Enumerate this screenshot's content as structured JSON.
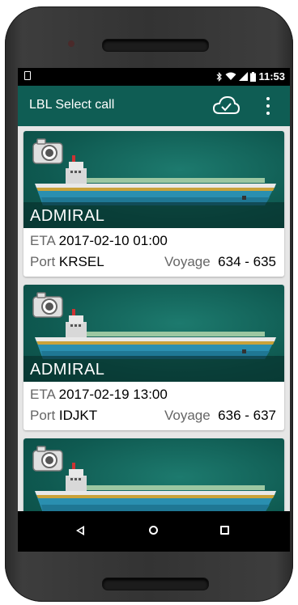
{
  "status_bar": {
    "time": "11:53",
    "icons": [
      "notification-icon",
      "bluetooth-icon",
      "wifi-icon",
      "signal-icon",
      "battery-icon"
    ]
  },
  "toolbar": {
    "title": "LBL Select call",
    "actions": [
      "cloud-check-icon",
      "overflow-menu-icon"
    ],
    "color": "#0f5d54"
  },
  "calls": [
    {
      "vessel": "ADMIRAL",
      "eta_label": "ETA",
      "eta": "2017-02-10 01:00",
      "port_label": "Port",
      "port": "KRSEL",
      "voyage_label": "Voyage",
      "voyage": "634 - 635"
    },
    {
      "vessel": "ADMIRAL",
      "eta_label": "ETA",
      "eta": "2017-02-19 13:00",
      "port_label": "Port",
      "port": "IDJKT",
      "voyage_label": "Voyage",
      "voyage": "636 - 637"
    },
    {
      "vessel": "",
      "eta_label": "",
      "eta": "",
      "port_label": "",
      "port": "",
      "voyage_label": "",
      "voyage": ""
    }
  ],
  "navigation": [
    "back-icon",
    "home-icon",
    "recents-icon"
  ]
}
